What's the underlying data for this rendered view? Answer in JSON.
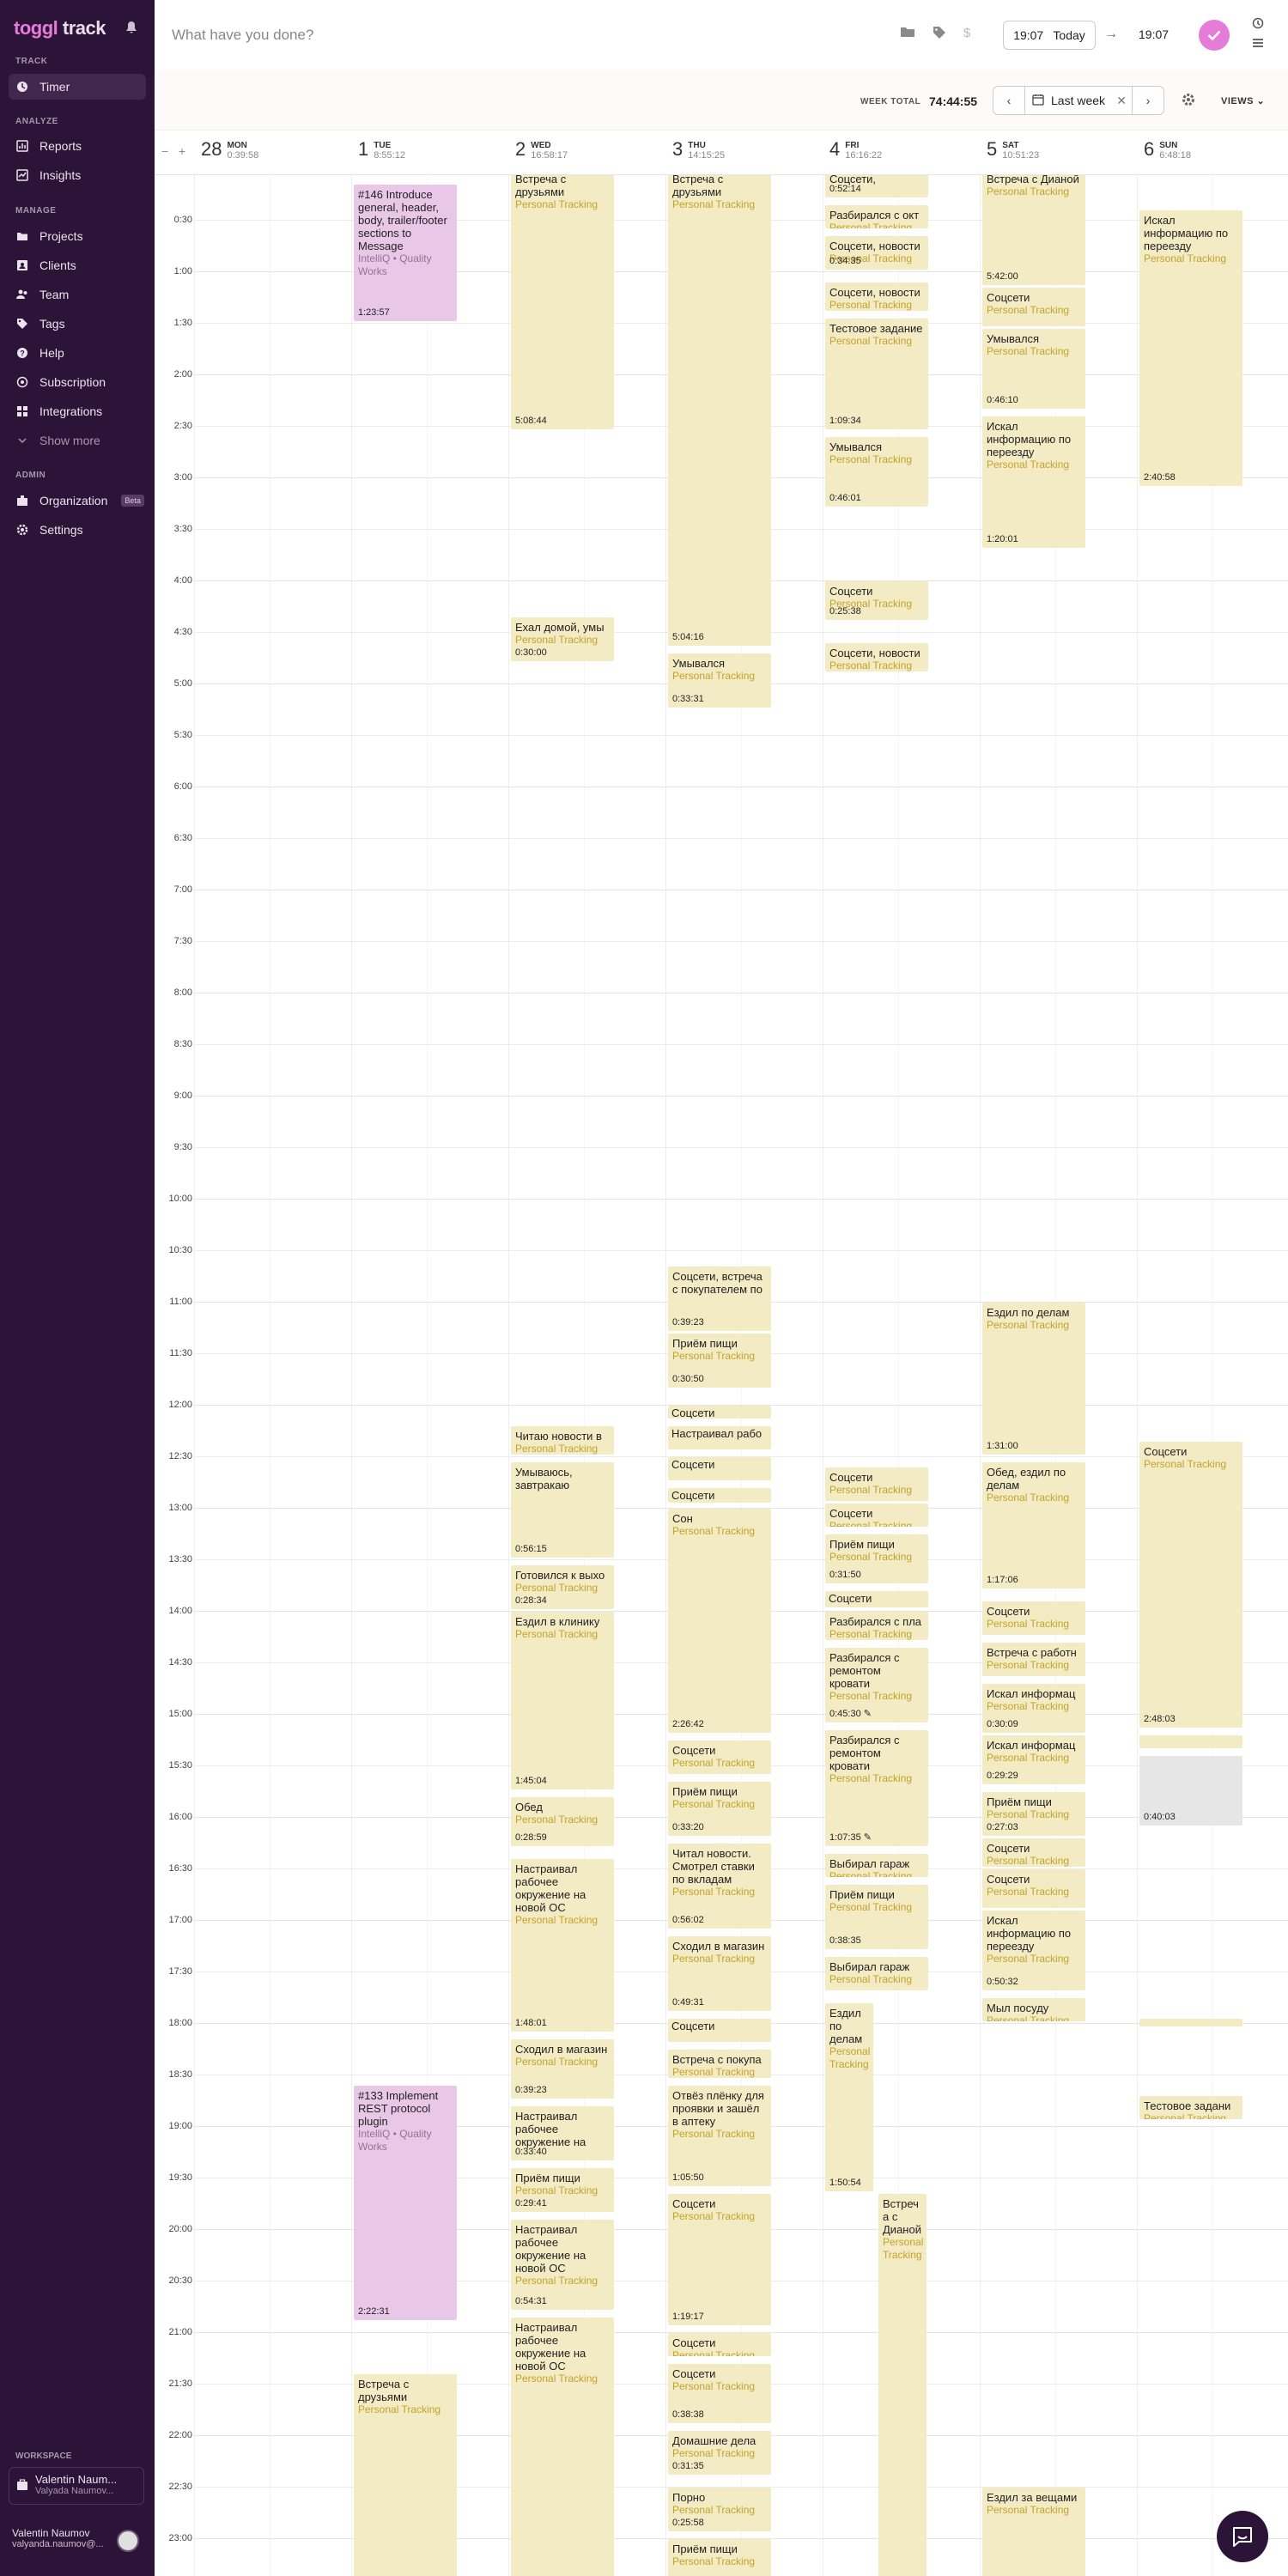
{
  "sidebar": {
    "logo_main": "toggl",
    "logo_sub": " track",
    "sections": {
      "track": "TRACK",
      "analyze": "ANALYZE",
      "manage": "MANAGE",
      "admin": "ADMIN"
    },
    "items": {
      "timer": "Timer",
      "reports": "Reports",
      "insights": "Insights",
      "projects": "Projects",
      "clients": "Clients",
      "team": "Team",
      "tags": "Tags",
      "help": "Help",
      "subscription": "Subscription",
      "integrations": "Integrations",
      "show_more": "Show more",
      "organization": "Organization",
      "beta": "Beta",
      "settings": "Settings"
    },
    "workspace_label": "WORKSPACE",
    "workspace_name": "Valentin Naum...",
    "workspace_sub": "Valyada Naumov...",
    "user_name": "Valentin Naumov",
    "user_email": "valyanda.naumov@..."
  },
  "topbar": {
    "description_placeholder": "What have you done?",
    "start_time": "19:07",
    "today": "Today",
    "end_time": "19:07"
  },
  "weekbar": {
    "week_total_label": "WEEK TOTAL",
    "week_total": "74:44:55",
    "range_label": "Last week",
    "views": "VIEWS"
  },
  "days": [
    {
      "num": "28",
      "name": "MON",
      "total": "0:39:58"
    },
    {
      "num": "1",
      "name": "TUE",
      "total": "8:55:12"
    },
    {
      "num": "2",
      "name": "WED",
      "total": "16:58:17"
    },
    {
      "num": "3",
      "name": "THU",
      "total": "14:15:25"
    },
    {
      "num": "4",
      "name": "FRI",
      "total": "16:16:22"
    },
    {
      "num": "5",
      "name": "SAT",
      "total": "10:51:23"
    },
    {
      "num": "6",
      "name": "SUN",
      "total": "6:48:18"
    }
  ],
  "hours": [
    "0:30",
    "1:00",
    "1:30",
    "2:00",
    "2:30",
    "3:00",
    "3:30",
    "4:00",
    "4:30",
    "5:00",
    "5:30",
    "6:00",
    "6:30",
    "7:00",
    "7:30",
    "8:00",
    "8:30",
    "9:00",
    "9:30",
    "10:00",
    "10:30",
    "11:00",
    "11:30",
    "12:00",
    "12:30",
    "13:00",
    "13:30",
    "14:00",
    "14:30",
    "15:00",
    "15:30",
    "16:00",
    "16:30",
    "17:00",
    "17:30",
    "18:00",
    "18:30",
    "19:00",
    "19:30",
    "20:00",
    "20:30",
    "21:00",
    "21:30",
    "22:00",
    "22:30",
    "23:00"
  ],
  "colors": {
    "sidebar": "#2c1338",
    "accent": "#e57cd8",
    "entry": "#f3ebc4",
    "entry_pink": "#e8c7e7",
    "project": "#c2a32a"
  },
  "entries": [
    {
      "day": 1,
      "start": 0.15,
      "end": 1.5,
      "title": "#146 Introduce general, header, body, trailer/footer sections to Message",
      "project": "IntelliQ • Quality Works",
      "dur": "1:23:57",
      "color": "pink"
    },
    {
      "day": 1,
      "start": 18.6,
      "end": 20.9,
      "title": "#133 Implement REST protocol plugin",
      "project": "IntelliQ • Quality Works",
      "dur": "2:22:31",
      "color": "pink"
    },
    {
      "day": 1,
      "start": 21.4,
      "end": 24,
      "title": "Встреча с друзьями",
      "project": "Personal Tracking",
      "dur": "",
      "color": "yellow"
    },
    {
      "day": 2,
      "start": 0.0,
      "end": 2.55,
      "title": "Встреча с друзьями",
      "project": "Personal Tracking",
      "dur": "5:08:44",
      "color": "yellow"
    },
    {
      "day": 2,
      "start": 4.35,
      "end": 4.8,
      "title": "Ехал домой, умы",
      "project": "Personal Tracking",
      "dur": "0:30:00",
      "color": "yellow"
    },
    {
      "day": 2,
      "start": 12.2,
      "end": 12.5,
      "title": "Читаю новости в",
      "project": "Personal Tracking",
      "dur": "",
      "color": "yellow"
    },
    {
      "day": 2,
      "start": 12.55,
      "end": 13.5,
      "title": "Умываюсь, завтракаю",
      "project": "",
      "dur": "0:56:15",
      "color": "yellow"
    },
    {
      "day": 2,
      "start": 13.55,
      "end": 14.0,
      "title": "Готовился к выхо",
      "project": "Personal Tracking",
      "dur": "0:28:34",
      "color": "yellow"
    },
    {
      "day": 2,
      "start": 14.0,
      "end": 15.75,
      "title": "Ездил в клинику",
      "project": "Personal Tracking",
      "dur": "1:45:04",
      "color": "yellow"
    },
    {
      "day": 2,
      "start": 15.8,
      "end": 16.3,
      "title": "Обед",
      "project": "Personal Tracking",
      "dur": "0:28:59",
      "color": "yellow"
    },
    {
      "day": 2,
      "start": 16.4,
      "end": 18.1,
      "title": "Настраивал рабочее окружение на новой ОС",
      "project": "Personal Tracking",
      "dur": "1:48:01",
      "color": "yellow"
    },
    {
      "day": 2,
      "start": 18.15,
      "end": 18.75,
      "title": "Сходил в магазин",
      "project": "Personal Tracking",
      "dur": "0:39:23",
      "color": "yellow"
    },
    {
      "day": 2,
      "start": 18.8,
      "end": 19.35,
      "title": "Настраивал рабочее окружение на",
      "project": "",
      "dur": "0:33:40",
      "color": "yellow"
    },
    {
      "day": 2,
      "start": 19.4,
      "end": 19.85,
      "title": "Приём пищи",
      "project": "Personal Tracking",
      "dur": "0:29:41",
      "color": "yellow"
    },
    {
      "day": 2,
      "start": 19.9,
      "end": 20.8,
      "title": "Настраивал рабочее окружение на новой ОС",
      "project": "Personal Tracking",
      "dur": "0:54:31",
      "color": "yellow"
    },
    {
      "day": 2,
      "start": 20.85,
      "end": 24,
      "title": "Настраивал рабочее окружение на новой ОС",
      "project": "Personal Tracking",
      "dur": "",
      "color": "yellow"
    },
    {
      "day": 3,
      "start": 0.0,
      "end": 4.65,
      "title": "Встреча с друзьями",
      "project": "Personal Tracking",
      "dur": "5:04:16",
      "color": "yellow"
    },
    {
      "day": 3,
      "start": 4.7,
      "end": 5.25,
      "title": "Умывался",
      "project": "Personal Tracking",
      "dur": "0:33:31",
      "color": "yellow"
    },
    {
      "day": 3,
      "start": 10.65,
      "end": 11.3,
      "title": "Соцсети, встреча с покупателем по",
      "project": "",
      "dur": "0:39:23",
      "color": "yellow"
    },
    {
      "day": 3,
      "start": 11.3,
      "end": 11.85,
      "title": "Приём пищи",
      "project": "Personal Tracking",
      "dur": "0:30:50",
      "color": "yellow"
    },
    {
      "day": 3,
      "start": 12.0,
      "end": 12.15,
      "title": "Соцсети",
      "project": "",
      "dur": "",
      "color": "yellow",
      "tiny": true
    },
    {
      "day": 3,
      "start": 12.2,
      "end": 12.45,
      "title": "Настраивал рабо",
      "project": "",
      "dur": "",
      "color": "yellow",
      "tiny": true
    },
    {
      "day": 3,
      "start": 12.5,
      "end": 12.75,
      "title": "Соцсети",
      "project": "",
      "dur": "",
      "color": "yellow",
      "tiny": true
    },
    {
      "day": 3,
      "start": 12.8,
      "end": 12.97,
      "title": "Соцсети",
      "project": "",
      "dur": "",
      "color": "yellow",
      "tiny": true
    },
    {
      "day": 3,
      "start": 13.0,
      "end": 15.2,
      "title": "Сон",
      "project": "Personal Tracking",
      "dur": "2:26:42",
      "color": "yellow"
    },
    {
      "day": 3,
      "start": 15.25,
      "end": 15.6,
      "title": "Соцсети",
      "project": "Personal Tracking",
      "dur": "",
      "color": "yellow"
    },
    {
      "day": 3,
      "start": 15.65,
      "end": 16.2,
      "title": "Приём пищи",
      "project": "Personal Tracking",
      "dur": "0:33:20",
      "color": "yellow"
    },
    {
      "day": 3,
      "start": 16.25,
      "end": 17.1,
      "title": "Читал новости. Смотрел ставки по вкладам",
      "project": "Personal Tracking",
      "dur": "0:56:02",
      "color": "yellow"
    },
    {
      "day": 3,
      "start": 17.15,
      "end": 17.9,
      "title": "Сходил в магазин",
      "project": "Personal Tracking",
      "dur": "0:49:31",
      "color": "yellow"
    },
    {
      "day": 3,
      "start": 17.95,
      "end": 18.2,
      "title": "Соцсети",
      "project": "",
      "dur": "",
      "color": "yellow",
      "tiny": true
    },
    {
      "day": 3,
      "start": 18.25,
      "end": 18.55,
      "title": "Встреча с покупа",
      "project": "Personal Tracking",
      "dur": "",
      "color": "yellow"
    },
    {
      "day": 3,
      "start": 18.6,
      "end": 19.6,
      "title": "Отвёз плёнку для проявки и зашёл в аптеку",
      "project": "Personal Tracking",
      "dur": "1:05:50",
      "color": "yellow"
    },
    {
      "day": 3,
      "start": 19.65,
      "end": 20.95,
      "title": "Соцсети",
      "project": "Personal Tracking",
      "dur": "1:19:17",
      "color": "yellow"
    },
    {
      "day": 3,
      "start": 21.0,
      "end": 21.25,
      "title": "Соцсети",
      "project": "Personal Tracking",
      "dur": "",
      "color": "yellow"
    },
    {
      "day": 3,
      "start": 21.3,
      "end": 21.9,
      "title": "Соцсети",
      "project": "Personal Tracking",
      "dur": "0:38:38",
      "color": "yellow"
    },
    {
      "day": 3,
      "start": 21.95,
      "end": 22.4,
      "title": "Домашние дела",
      "project": "Personal Tracking",
      "dur": "0:31:35",
      "color": "yellow"
    },
    {
      "day": 3,
      "start": 22.5,
      "end": 22.95,
      "title": "Порно",
      "project": "Personal Tracking",
      "dur": "0:25:58",
      "color": "yellow"
    },
    {
      "day": 3,
      "start": 23.0,
      "end": 24,
      "title": "Приём пищи",
      "project": "Personal Tracking",
      "dur": "",
      "color": "yellow"
    },
    {
      "day": 4,
      "start": 0.0,
      "end": 0.3,
      "title": "Соцсети,",
      "project": "",
      "dur": "0:52:14",
      "color": "yellow"
    },
    {
      "day": 4,
      "start": 0.35,
      "end": 0.6,
      "title": "Разбирался с окт",
      "project": "Personal Tracking",
      "dur": "",
      "color": "yellow"
    },
    {
      "day": 4,
      "start": 0.65,
      "end": 1.0,
      "title": "Соцсети, новости",
      "project": "Personal Tracking",
      "dur": "0:34:35",
      "color": "yellow"
    },
    {
      "day": 4,
      "start": 1.1,
      "end": 1.4,
      "title": "Соцсети, новости",
      "project": "Personal Tracking",
      "dur": "",
      "color": "yellow"
    },
    {
      "day": 4,
      "start": 1.45,
      "end": 2.55,
      "title": "Тестовое задание",
      "project": "Personal Tracking",
      "dur": "1:09:34",
      "color": "yellow"
    },
    {
      "day": 4,
      "start": 2.6,
      "end": 3.3,
      "title": "Умывался",
      "project": "Personal Tracking",
      "dur": "0:46:01",
      "color": "yellow"
    },
    {
      "day": 4,
      "start": 4.0,
      "end": 4.4,
      "title": "Соцсети",
      "project": "Personal Tracking",
      "dur": "0:25:38",
      "color": "yellow"
    },
    {
      "day": 4,
      "start": 4.6,
      "end": 4.9,
      "title": "Соцсети, новости",
      "project": "Personal Tracking",
      "dur": "",
      "color": "yellow"
    },
    {
      "day": 4,
      "start": 12.6,
      "end": 12.95,
      "title": "Соцсети",
      "project": "Personal Tracking",
      "dur": "",
      "color": "yellow"
    },
    {
      "day": 4,
      "start": 12.95,
      "end": 13.2,
      "title": "Соцсети",
      "project": "Personal Tracking",
      "dur": "",
      "color": "yellow"
    },
    {
      "day": 4,
      "start": 13.25,
      "end": 13.75,
      "title": "Приём пищи",
      "project": "Personal Tracking",
      "dur": "0:31:50",
      "color": "yellow"
    },
    {
      "day": 4,
      "start": 13.8,
      "end": 13.98,
      "title": "Соцсети",
      "project": "",
      "dur": "",
      "color": "yellow",
      "tiny": true
    },
    {
      "day": 4,
      "start": 14.0,
      "end": 14.3,
      "title": "Разбирался с пла",
      "project": "Personal Tracking",
      "dur": "",
      "color": "yellow"
    },
    {
      "day": 4,
      "start": 14.35,
      "end": 15.1,
      "title": "Разбирался с ремонтом кровати",
      "project": "Personal Tracking",
      "dur": "0:45:30 ✎",
      "color": "yellow"
    },
    {
      "day": 4,
      "start": 15.15,
      "end": 16.3,
      "title": "Разбирался с ремонтом кровати",
      "project": "Personal Tracking",
      "dur": "1:07:35 ✎",
      "color": "yellow"
    },
    {
      "day": 4,
      "start": 16.35,
      "end": 16.6,
      "title": "Выбирал гараж",
      "project": "Personal Tracking",
      "dur": "",
      "color": "yellow"
    },
    {
      "day": 4,
      "start": 16.65,
      "end": 17.3,
      "title": "Приём пищи",
      "project": "Personal Tracking",
      "dur": "0:38:35",
      "color": "yellow"
    },
    {
      "day": 4,
      "start": 17.35,
      "end": 17.7,
      "title": "Выбирал гараж",
      "project": "Personal Tracking",
      "dur": "",
      "color": "yellow"
    },
    {
      "day": 4,
      "start": 17.8,
      "end": 19.65,
      "title": "Ездил по делам",
      "project": "Personal Tracking",
      "dur": "1:50:54",
      "color": "yellow",
      "half": "left"
    },
    {
      "day": 4,
      "start": 19.65,
      "end": 24,
      "title": "Встреча с Дианой",
      "project": "Personal Tracking",
      "dur": "",
      "color": "yellow",
      "half": "right"
    },
    {
      "day": 5,
      "start": 0.0,
      "end": 1.15,
      "title": "Встреча с Дианой",
      "project": "Personal Tracking",
      "dur": "5:42:00",
      "color": "yellow"
    },
    {
      "day": 5,
      "start": 1.15,
      "end": 1.55,
      "title": "Соцсети",
      "project": "Personal Tracking",
      "dur": "",
      "color": "yellow"
    },
    {
      "day": 5,
      "start": 1.55,
      "end": 2.35,
      "title": "Умывался",
      "project": "Personal Tracking",
      "dur": "0:46:10",
      "color": "yellow"
    },
    {
      "day": 5,
      "start": 2.4,
      "end": 3.7,
      "title": "Искал информацию по переезду",
      "project": "Personal Tracking",
      "dur": "1:20:01",
      "color": "yellow"
    },
    {
      "day": 5,
      "start": 11.0,
      "end": 12.5,
      "title": "Ездил по делам",
      "project": "Personal Tracking",
      "dur": "1:31:00",
      "color": "yellow"
    },
    {
      "day": 5,
      "start": 12.55,
      "end": 13.8,
      "title": "Обед, ездил по делам",
      "project": "Personal Tracking",
      "dur": "1:17:06",
      "color": "yellow"
    },
    {
      "day": 5,
      "start": 13.9,
      "end": 14.25,
      "title": "Соцсети",
      "project": "Personal Tracking",
      "dur": "",
      "color": "yellow"
    },
    {
      "day": 5,
      "start": 14.3,
      "end": 14.65,
      "title": "Встреча с работн",
      "project": "Personal Tracking",
      "dur": "",
      "color": "yellow"
    },
    {
      "day": 5,
      "start": 14.7,
      "end": 15.2,
      "title": "Искал информац",
      "project": "Personal Tracking",
      "dur": "0:30:09",
      "color": "yellow"
    },
    {
      "day": 5,
      "start": 15.2,
      "end": 15.7,
      "title": "Искал информац",
      "project": "Personal Tracking",
      "dur": "0:29:29",
      "color": "yellow"
    },
    {
      "day": 5,
      "start": 15.75,
      "end": 16.2,
      "title": "Приём пищи",
      "project": "Personal Tracking",
      "dur": "0:27:03",
      "color": "yellow"
    },
    {
      "day": 5,
      "start": 16.2,
      "end": 16.5,
      "title": "Соцсети",
      "project": "Personal Tracking",
      "dur": "",
      "color": "yellow"
    },
    {
      "day": 5,
      "start": 16.5,
      "end": 16.9,
      "title": "Соцсети",
      "project": "Personal Tracking",
      "dur": "",
      "color": "yellow"
    },
    {
      "day": 5,
      "start": 16.9,
      "end": 17.7,
      "title": "Искал информацию по переезду",
      "project": "Personal Tracking",
      "dur": "0:50:32",
      "color": "yellow"
    },
    {
      "day": 5,
      "start": 17.75,
      "end": 18.0,
      "title": "Мыл посуду",
      "project": "Personal Tracking",
      "dur": "",
      "color": "yellow"
    },
    {
      "day": 5,
      "start": 22.5,
      "end": 24,
      "title": "Ездил за вещами",
      "project": "Personal Tracking",
      "dur": "",
      "color": "yellow"
    },
    {
      "day": 6,
      "start": 0.4,
      "end": 3.1,
      "title": "Искал информацию по переезду",
      "project": "Personal Tracking",
      "dur": "2:40:58",
      "color": "yellow"
    },
    {
      "day": 6,
      "start": 12.35,
      "end": 15.15,
      "title": "Соцсети",
      "project": "Personal Tracking",
      "dur": "2:48:03",
      "color": "yellow"
    },
    {
      "day": 6,
      "start": 15.2,
      "end": 15.35,
      "title": "",
      "project": "",
      "dur": "",
      "color": "yellow",
      "tiny": true
    },
    {
      "day": 6,
      "start": 15.4,
      "end": 16.1,
      "title": "",
      "project": "",
      "dur": "0:40:03",
      "color": "gray"
    },
    {
      "day": 6,
      "start": 17.95,
      "end": 18.05,
      "title": "",
      "project": "",
      "dur": "",
      "color": "yellow",
      "tiny": true
    },
    {
      "day": 6,
      "start": 18.7,
      "end": 18.95,
      "title": "Тестовое задани",
      "project": "Personal Tracking",
      "dur": "",
      "color": "yellow"
    },
    {
      "day": 0,
      "start": 23.6,
      "end": 24,
      "title": "",
      "project": "",
      "dur": "",
      "color": "pink",
      "tiny": true
    }
  ]
}
